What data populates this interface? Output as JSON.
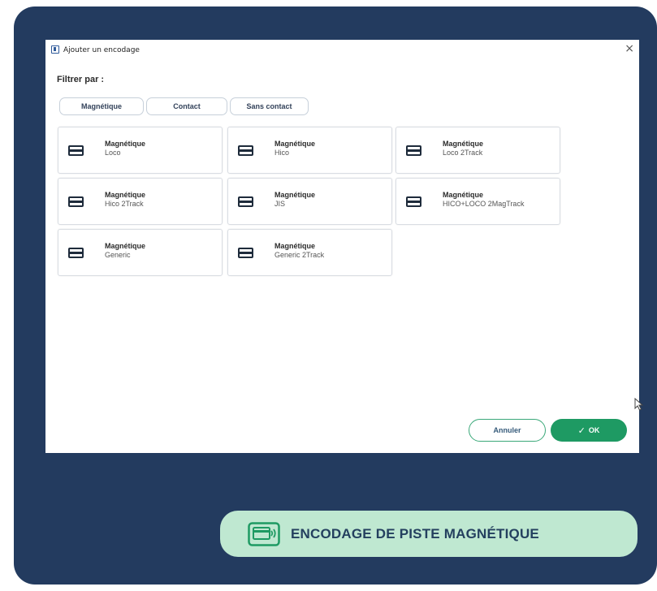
{
  "dialog": {
    "title": "Ajouter un encodage",
    "close_glyph": "×",
    "filter_label": "Filtrer par :",
    "filters": [
      "Magnétique",
      "Contact",
      "Sans contact"
    ],
    "tiles": [
      {
        "title": "Magnétique",
        "subtitle": "Loco"
      },
      {
        "title": "Magnétique",
        "subtitle": "Hico"
      },
      {
        "title": "Magnétique",
        "subtitle": "Loco 2Track"
      },
      {
        "title": "Magnétique",
        "subtitle": "Hico 2Track"
      },
      {
        "title": "Magnétique",
        "subtitle": "JIS"
      },
      {
        "title": "Magnétique",
        "subtitle": "HICO+LOCO 2MagTrack"
      },
      {
        "title": "Magnétique",
        "subtitle": "Generic"
      },
      {
        "title": "Magnétique",
        "subtitle": "Generic 2Track"
      }
    ],
    "cancel_label": "Annuler",
    "ok_label": "OK",
    "ok_icon": "✓",
    "tile_icon": "magnetic-card-icon"
  },
  "caption": {
    "text": "ENCODAGE DE PISTE MAGNÉTIQUE",
    "icon": "card-reader-icon"
  },
  "colors": {
    "frame_background": "#233b5f",
    "accent_green": "#1e9a63",
    "caption_background": "#bfe8d1",
    "caption_text": "#24405f"
  }
}
